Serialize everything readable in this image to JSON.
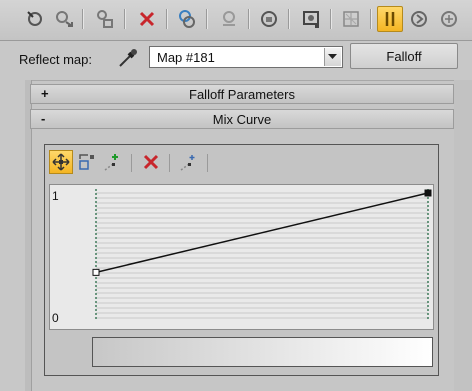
{
  "toolbar": {
    "icons": [
      "pick-material-icon",
      "put-to-scene-icon",
      "assign-material-icon",
      "reset-map-icon",
      "make-unique-icon",
      "put-to-library-icon",
      "material-id-channel-icon",
      "show-shaded-material-icon",
      "show-end-result-icon",
      "go-to-parent-icon",
      "go-forward-to-sibling-icon"
    ]
  },
  "reflect_map": {
    "label": "Reflect map:",
    "map_value": "Map #181",
    "map_type_button": "Falloff"
  },
  "rollouts": {
    "falloff_parameters": {
      "sign": "+",
      "title": "Falloff Parameters"
    },
    "mix_curve": {
      "sign": "-",
      "title": "Mix Curve"
    }
  },
  "curve_editor": {
    "tools": [
      "move-icon",
      "scale-point-icon",
      "insert-corner-point-icon",
      "delete-point-icon",
      "reset-curves-icon"
    ],
    "y_max_label": "1",
    "y_min_label": "0",
    "curve_points": [
      {
        "x": 0.0,
        "y": 0.38
      },
      {
        "x": 1.0,
        "y": 1.0
      }
    ]
  },
  "colors": {
    "active_button": "#f4b523",
    "panel_bg": "#c6c6c6",
    "graph_bg": "#e9e9e9"
  }
}
